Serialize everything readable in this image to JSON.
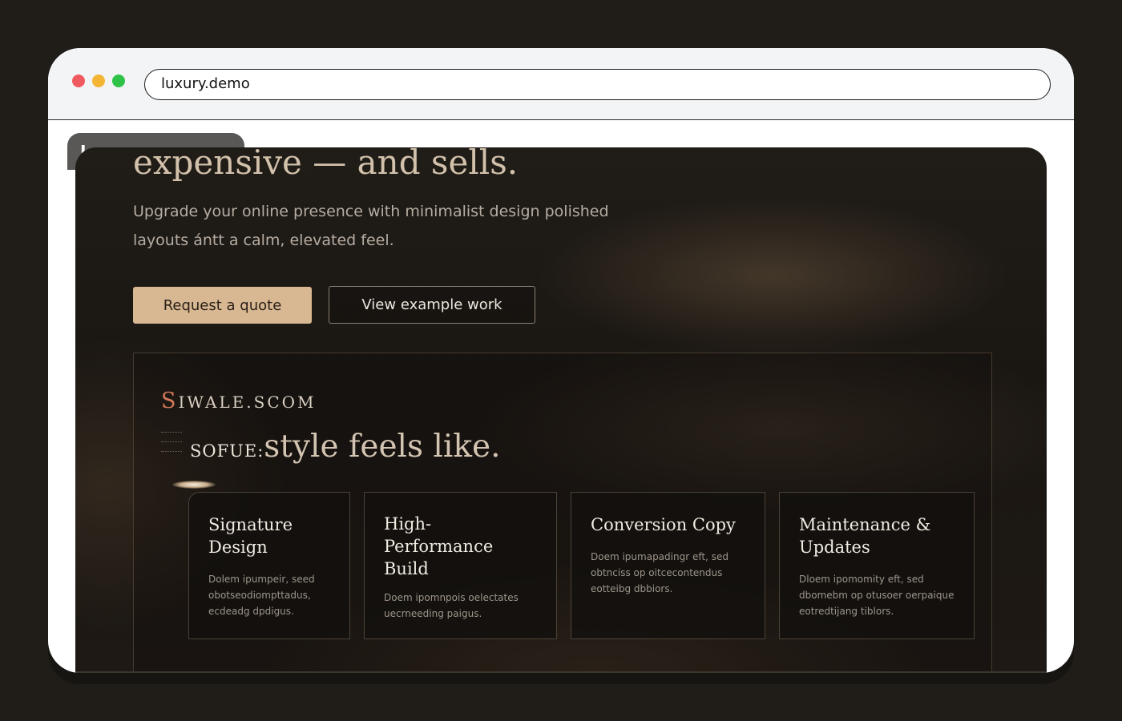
{
  "browser": {
    "url": "luxury.demo",
    "tab_label": "Luxury"
  },
  "hero": {
    "title": "expensive — and sells.",
    "subtitle": "Upgrade your online presence with minimalist design polished layouts ántt a calm, elevated feel.",
    "primary_button": "Request a quote",
    "secondary_button": "View example work"
  },
  "showcase": {
    "brand_first": "S",
    "brand_rest": "IWALE.SCOM",
    "heading_small": "SOFUE:",
    "heading_large": "style feels like."
  },
  "cards": [
    {
      "title": "Signature Design",
      "desc": "Dolem ipumpeir, seed obotseodiompttadus, ecdeadg dpdigus."
    },
    {
      "title": "High-Performance Build",
      "desc": "Doem ipomnpois oelectates uecrneeding paigus."
    },
    {
      "title": "Conversion Copy",
      "desc": "Doem ipumapadingr eft, sed obtnciss op oitcecontendus eotteibg dbbiors."
    },
    {
      "title": "Maintenance & Updates",
      "desc": "Dloem ipomomity eft, sed dbomebm op otusoer oerpaique eotredtijang tiblors."
    }
  ],
  "colors": {
    "accent_button": "#d8b892",
    "brand_initial": "#d17858",
    "background": "#201c17"
  },
  "icons": [
    "close-dot-icon",
    "minimize-dot-icon",
    "maximize-dot-icon"
  ]
}
